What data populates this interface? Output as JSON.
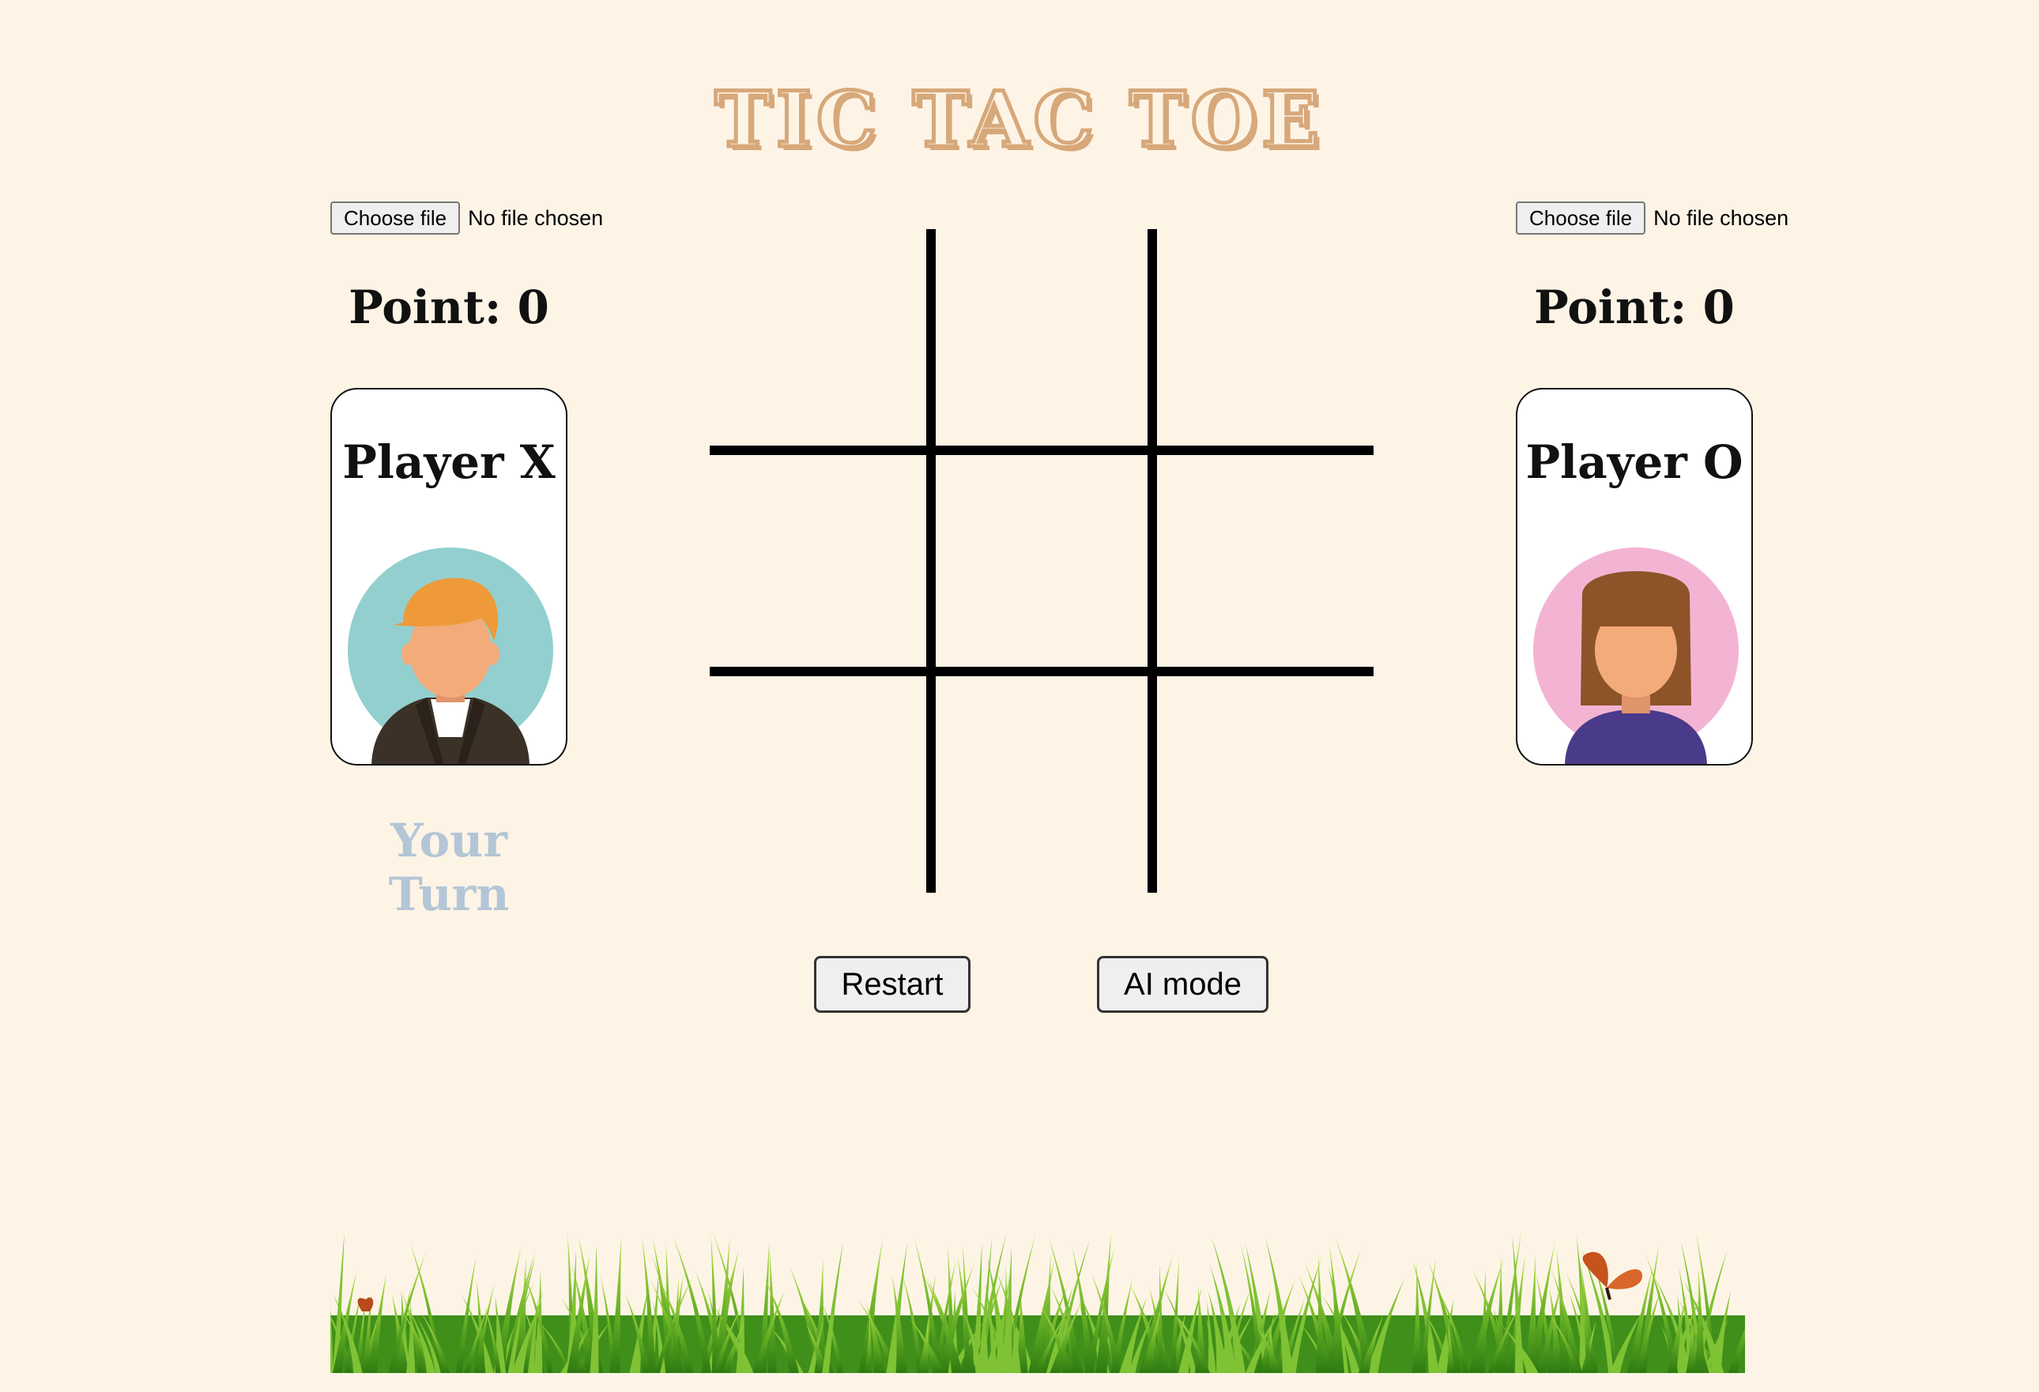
{
  "title": "TIC TAC TOE",
  "player_x": {
    "file_button": "Choose file",
    "file_status": "No file chosen",
    "points_text": "Point: 0",
    "name": "Player X",
    "turn_text": "Your Turn"
  },
  "player_o": {
    "file_button": "Choose file",
    "file_status": "No file chosen",
    "points_text": "Point: 0",
    "name": "Player O"
  },
  "board": {
    "cells": [
      "",
      "",
      "",
      "",
      "",
      "",
      "",
      "",
      ""
    ]
  },
  "controls": {
    "restart_label": "Restart",
    "ai_mode_label": "AI mode"
  },
  "colors": {
    "background": "#fdf4e6",
    "title": "#d7a87a",
    "turn_text": "#b3c6d6",
    "avatar_x_bg": "#93cfcf",
    "avatar_o_bg": "#f3b4d4"
  }
}
